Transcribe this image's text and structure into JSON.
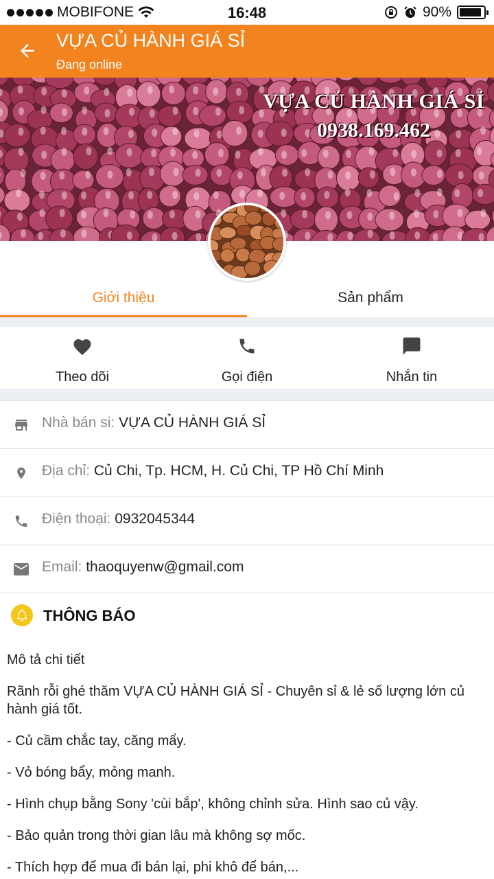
{
  "status": {
    "carrier": "MOBIFONE",
    "time": "16:48",
    "battery": "90%",
    "battery_level": 0.9
  },
  "header": {
    "title": "VỰA CỦ HÀNH GIÁ SỈ",
    "subtitle": "Đang online"
  },
  "cover": {
    "title": "VỰA CỦ HÀNH GIÁ SỈ",
    "phone": "0938.169.462"
  },
  "tabs": [
    {
      "label": "Giới thiệu",
      "active": true
    },
    {
      "label": "Sản phẩm",
      "active": false
    }
  ],
  "actions": [
    {
      "label": "Theo dõi",
      "icon": "heart-icon"
    },
    {
      "label": "Gọi điện",
      "icon": "phone-icon"
    },
    {
      "label": "Nhắn tin",
      "icon": "message-icon"
    }
  ],
  "info": {
    "seller": {
      "label": "Nhà bán si:",
      "value": "VỰA CỦ HÀNH GIÁ SỈ",
      "icon": "store-icon"
    },
    "address": {
      "label": "Địa chỉ:",
      "value": "Củ Chi, Tp. HCM, H. Củ Chi, TP Hồ Chí Minh",
      "icon": "location-icon"
    },
    "phone": {
      "label": "Điện thoại:",
      "value": "0932045344",
      "icon": "phone-icon"
    },
    "email": {
      "label": "Email:",
      "value": "thaoquyenw@gmail.com",
      "icon": "mail-icon"
    }
  },
  "notice": {
    "title": "THÔNG BÁO",
    "icon": "bell-icon"
  },
  "description": [
    "Mô tả chi tiết",
    "Rãnh rỗi ghé thăm VỰA CỦ HÀNH GIÁ SỈ - Chuyên sỉ & lẻ số lượng lớn củ hành giá tốt.",
    "- Củ cầm chắc tay, căng mẩy.",
    "- Vỏ bóng bẩy, mỏng manh.",
    "- Hình chụp bằng Sony 'cùi bắp', không chỉnh sửa. Hình sao củ vậy.",
    "- Bảo quản trong thời gian lâu mà không sợ mốc.",
    "- Thích hợp để mua đi bán lại, phi khô để bán,..."
  ],
  "colors": {
    "accent": "#f2831e",
    "bell": "#f5c518"
  }
}
